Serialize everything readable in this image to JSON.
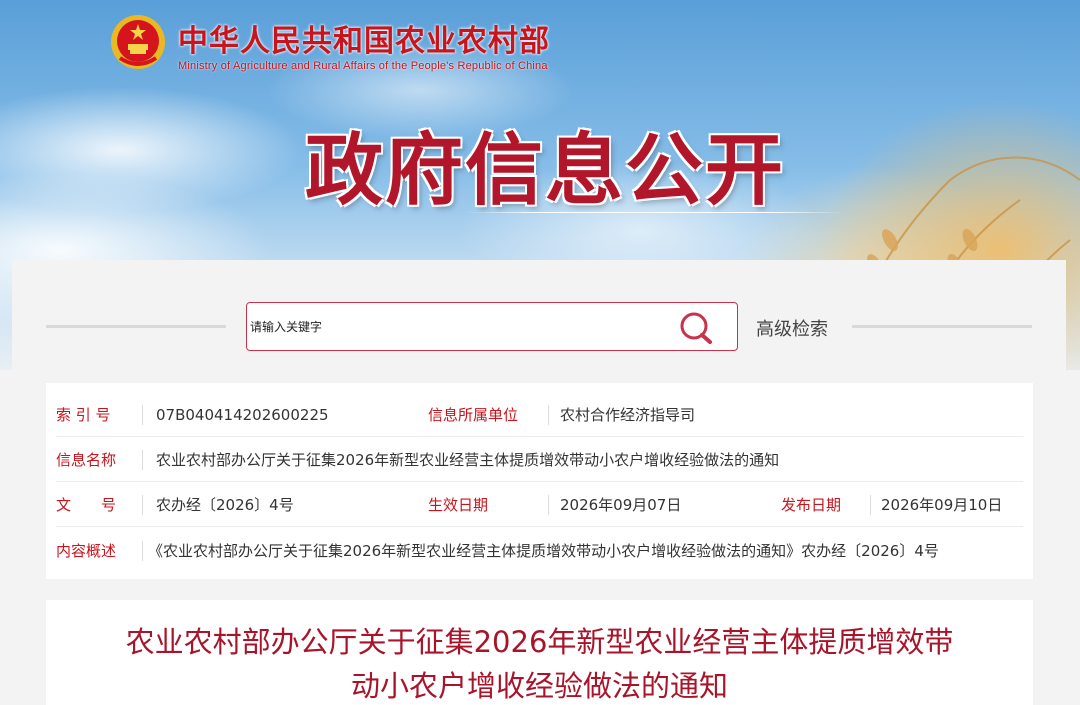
{
  "header": {
    "ministry_cn": "中华人民共和国农业农村部",
    "ministry_en": "Ministry of Agriculture and Rural Affairs of the People's Republic of China",
    "section_title": "政府信息公开",
    "emblem_icon": "national-emblem-icon"
  },
  "search": {
    "placeholder": "请输入关键字",
    "icon": "search-icon",
    "advanced_label": "高级检索"
  },
  "info": {
    "index_label": "索 引 号",
    "index_value": "07B040414202600225",
    "unit_label": "信息所属单位",
    "unit_value": "农村合作经济指导司",
    "name_label": "信息名称",
    "name_value": "农业农村部办公厅关于征集2026年新型农业经营主体提质增效带动小农户增收经验做法的通知",
    "doc_label": "文　　号",
    "doc_value": "农办经〔2026〕4号",
    "effective_label": "生效日期",
    "effective_value": "2026年09月07日",
    "publish_label": "发布日期",
    "publish_value": "2026年09月10日",
    "summary_label": "内容概述",
    "summary_value": "《农业农村部办公厅关于征集2026年新型农业经营主体提质增效带动小农户增收经验做法的通知》农办经〔2026〕4号"
  },
  "article": {
    "title_line1": "农业农村部办公厅关于征集2026年新型农业经营主体提质增效带",
    "title_line2": "动小农户增收经验做法的通知"
  },
  "colors": {
    "brand_red": "#c8141c",
    "title_red": "#a8142a",
    "search_border": "#c8324a"
  }
}
